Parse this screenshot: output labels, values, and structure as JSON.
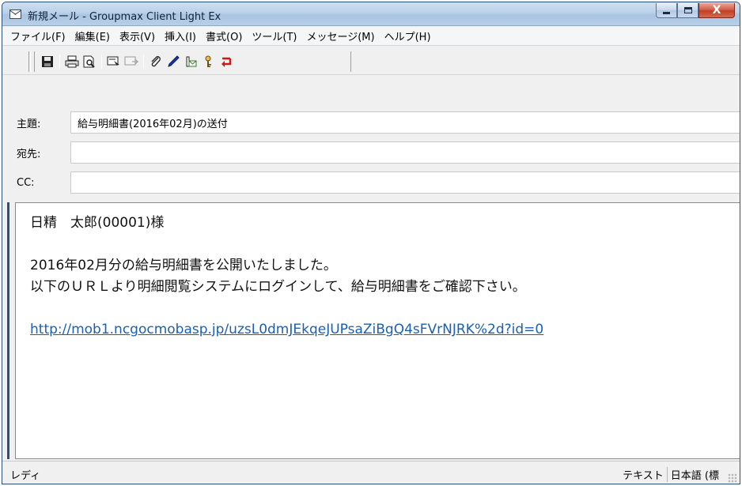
{
  "window": {
    "title": "新規メール - Groupmax Client Light Ex",
    "minimize_label": "",
    "maximize_label": "",
    "close_label": "X"
  },
  "menu": {
    "items": [
      {
        "label": "ファイル(F)"
      },
      {
        "label": "編集(E)"
      },
      {
        "label": "表示(V)"
      },
      {
        "label": "挿入(I)"
      },
      {
        "label": "書式(O)"
      },
      {
        "label": "ツール(T)"
      },
      {
        "label": "メッセージ(M)"
      },
      {
        "label": "ヘルプ(H)"
      }
    ]
  },
  "toolbar": {
    "icons": [
      "save-icon",
      "print-icon",
      "print-preview-icon",
      "select-icon",
      "insert-icon",
      "attach-icon",
      "pen-icon",
      "address-icon",
      "key-icon",
      "undo-icon"
    ],
    "colors": {
      "undo": "#d01818",
      "key": "#c8a21a",
      "address": "#3a7a2a",
      "pen": "#1a3aa8"
    }
  },
  "fields": {
    "subject": {
      "label": "主題:",
      "value": "給与明細書(2016年02月)の送付"
    },
    "to": {
      "label": "宛先:",
      "value": ""
    },
    "cc": {
      "label": "CC:",
      "value": ""
    }
  },
  "body": {
    "line1": "日精　太郎(00001)様",
    "line2": "2016年02月分の給与明細書を公開いたしました。",
    "line3": "以下のＵＲＬより明細閲覧システムにログインして、給与明細書をご確認下さい。",
    "link": "http://mob1.ncgocmobasp.jp/uzsL0dmJEkqeJUPsaZiBgQ4sFVrNJRK%2d?id=0",
    "link_color": "#1a5fb4"
  },
  "status": {
    "left": "レディ",
    "format": "テキスト",
    "encoding": "日本語 (標"
  }
}
